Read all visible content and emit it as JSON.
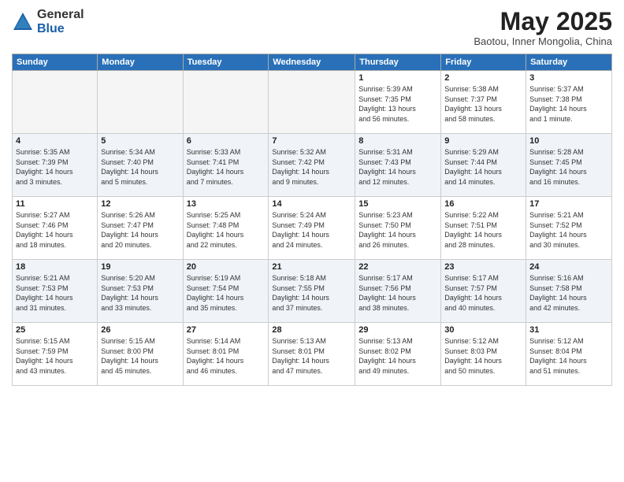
{
  "logo": {
    "general": "General",
    "blue": "Blue"
  },
  "title": "May 2025",
  "subtitle": "Baotou, Inner Mongolia, China",
  "weekdays": [
    "Sunday",
    "Monday",
    "Tuesday",
    "Wednesday",
    "Thursday",
    "Friday",
    "Saturday"
  ],
  "weeks": [
    [
      {
        "day": "",
        "info": ""
      },
      {
        "day": "",
        "info": ""
      },
      {
        "day": "",
        "info": ""
      },
      {
        "day": "",
        "info": ""
      },
      {
        "day": "1",
        "info": "Sunrise: 5:39 AM\nSunset: 7:35 PM\nDaylight: 13 hours\nand 56 minutes."
      },
      {
        "day": "2",
        "info": "Sunrise: 5:38 AM\nSunset: 7:37 PM\nDaylight: 13 hours\nand 58 minutes."
      },
      {
        "day": "3",
        "info": "Sunrise: 5:37 AM\nSunset: 7:38 PM\nDaylight: 14 hours\nand 1 minute."
      }
    ],
    [
      {
        "day": "4",
        "info": "Sunrise: 5:35 AM\nSunset: 7:39 PM\nDaylight: 14 hours\nand 3 minutes."
      },
      {
        "day": "5",
        "info": "Sunrise: 5:34 AM\nSunset: 7:40 PM\nDaylight: 14 hours\nand 5 minutes."
      },
      {
        "day": "6",
        "info": "Sunrise: 5:33 AM\nSunset: 7:41 PM\nDaylight: 14 hours\nand 7 minutes."
      },
      {
        "day": "7",
        "info": "Sunrise: 5:32 AM\nSunset: 7:42 PM\nDaylight: 14 hours\nand 9 minutes."
      },
      {
        "day": "8",
        "info": "Sunrise: 5:31 AM\nSunset: 7:43 PM\nDaylight: 14 hours\nand 12 minutes."
      },
      {
        "day": "9",
        "info": "Sunrise: 5:29 AM\nSunset: 7:44 PM\nDaylight: 14 hours\nand 14 minutes."
      },
      {
        "day": "10",
        "info": "Sunrise: 5:28 AM\nSunset: 7:45 PM\nDaylight: 14 hours\nand 16 minutes."
      }
    ],
    [
      {
        "day": "11",
        "info": "Sunrise: 5:27 AM\nSunset: 7:46 PM\nDaylight: 14 hours\nand 18 minutes."
      },
      {
        "day": "12",
        "info": "Sunrise: 5:26 AM\nSunset: 7:47 PM\nDaylight: 14 hours\nand 20 minutes."
      },
      {
        "day": "13",
        "info": "Sunrise: 5:25 AM\nSunset: 7:48 PM\nDaylight: 14 hours\nand 22 minutes."
      },
      {
        "day": "14",
        "info": "Sunrise: 5:24 AM\nSunset: 7:49 PM\nDaylight: 14 hours\nand 24 minutes."
      },
      {
        "day": "15",
        "info": "Sunrise: 5:23 AM\nSunset: 7:50 PM\nDaylight: 14 hours\nand 26 minutes."
      },
      {
        "day": "16",
        "info": "Sunrise: 5:22 AM\nSunset: 7:51 PM\nDaylight: 14 hours\nand 28 minutes."
      },
      {
        "day": "17",
        "info": "Sunrise: 5:21 AM\nSunset: 7:52 PM\nDaylight: 14 hours\nand 30 minutes."
      }
    ],
    [
      {
        "day": "18",
        "info": "Sunrise: 5:21 AM\nSunset: 7:53 PM\nDaylight: 14 hours\nand 31 minutes."
      },
      {
        "day": "19",
        "info": "Sunrise: 5:20 AM\nSunset: 7:53 PM\nDaylight: 14 hours\nand 33 minutes."
      },
      {
        "day": "20",
        "info": "Sunrise: 5:19 AM\nSunset: 7:54 PM\nDaylight: 14 hours\nand 35 minutes."
      },
      {
        "day": "21",
        "info": "Sunrise: 5:18 AM\nSunset: 7:55 PM\nDaylight: 14 hours\nand 37 minutes."
      },
      {
        "day": "22",
        "info": "Sunrise: 5:17 AM\nSunset: 7:56 PM\nDaylight: 14 hours\nand 38 minutes."
      },
      {
        "day": "23",
        "info": "Sunrise: 5:17 AM\nSunset: 7:57 PM\nDaylight: 14 hours\nand 40 minutes."
      },
      {
        "day": "24",
        "info": "Sunrise: 5:16 AM\nSunset: 7:58 PM\nDaylight: 14 hours\nand 42 minutes."
      }
    ],
    [
      {
        "day": "25",
        "info": "Sunrise: 5:15 AM\nSunset: 7:59 PM\nDaylight: 14 hours\nand 43 minutes."
      },
      {
        "day": "26",
        "info": "Sunrise: 5:15 AM\nSunset: 8:00 PM\nDaylight: 14 hours\nand 45 minutes."
      },
      {
        "day": "27",
        "info": "Sunrise: 5:14 AM\nSunset: 8:01 PM\nDaylight: 14 hours\nand 46 minutes."
      },
      {
        "day": "28",
        "info": "Sunrise: 5:13 AM\nSunset: 8:01 PM\nDaylight: 14 hours\nand 47 minutes."
      },
      {
        "day": "29",
        "info": "Sunrise: 5:13 AM\nSunset: 8:02 PM\nDaylight: 14 hours\nand 49 minutes."
      },
      {
        "day": "30",
        "info": "Sunrise: 5:12 AM\nSunset: 8:03 PM\nDaylight: 14 hours\nand 50 minutes."
      },
      {
        "day": "31",
        "info": "Sunrise: 5:12 AM\nSunset: 8:04 PM\nDaylight: 14 hours\nand 51 minutes."
      }
    ]
  ]
}
